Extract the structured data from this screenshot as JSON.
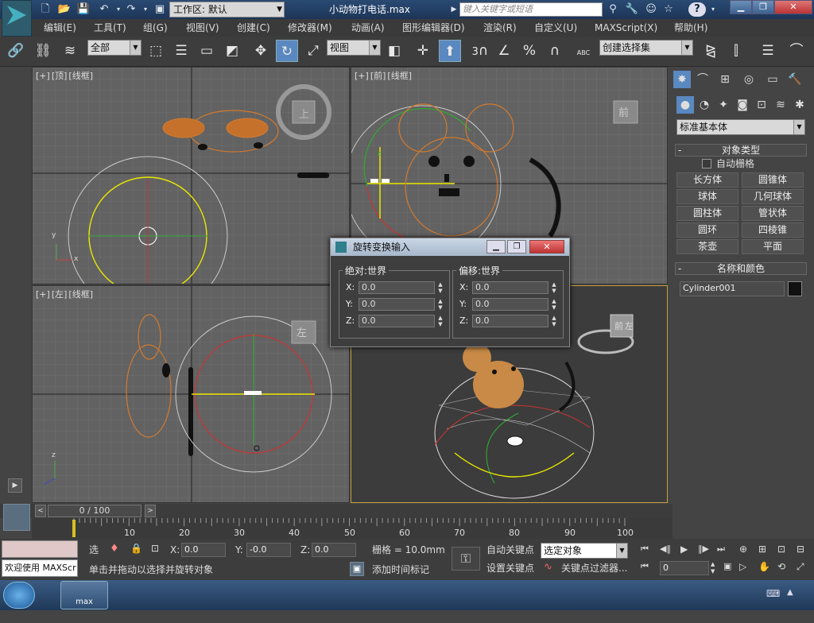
{
  "window": {
    "file_title": "小动物打电话.max",
    "workspace": "工作区: 默认",
    "search_placeholder": "键入关键字或短语",
    "title_icons": [
      "new-file",
      "open-folder",
      "save",
      "undo",
      "redo",
      "hold"
    ],
    "help": "?"
  },
  "menu": [
    "编辑(E)",
    "工具(T)",
    "组(G)",
    "视图(V)",
    "创建(C)",
    "修改器(M)",
    "动画(A)",
    "图形编辑器(D)",
    "渲染(R)",
    "自定义(U)",
    "MAXScript(X)",
    "帮助(H)"
  ],
  "toolbar": {
    "selection_filter": "全部",
    "ref_coord": "视图",
    "named_selection": "创建选择集",
    "snap_label": "3",
    "angle_snap": "%",
    "abc": "ABC"
  },
  "viewports": {
    "top": {
      "label": [
        "[+]",
        "[顶]",
        "[线框]"
      ],
      "cube": "上"
    },
    "front": {
      "label": [
        "[+]",
        "[前]",
        "[线框]"
      ],
      "cube": "前"
    },
    "left": {
      "label": [
        "[+]",
        "[左]",
        "[线框]"
      ],
      "cube": "左"
    },
    "persp": {
      "cube_front": "前",
      "cube_side": "左"
    }
  },
  "axes": {
    "x": "x",
    "y": "y",
    "z": "z"
  },
  "command_panel": {
    "dropdown": "标准基本体",
    "object_type_title": "对象类型",
    "autogrid": "自动栅格",
    "buttons": [
      "长方体",
      "圆锥体",
      "球体",
      "几何球体",
      "圆柱体",
      "管状体",
      "圆环",
      "四棱锥",
      "茶壶",
      "平面"
    ],
    "name_color_title": "名称和颜色",
    "object_name": "Cylinder001",
    "object_color": "#111111"
  },
  "dialog": {
    "title": "旋转变换输入",
    "abs_title": "绝对:世界",
    "off_title": "偏移:世界",
    "rows": [
      {
        "axis": "X:",
        "abs": "0.0",
        "off": "0.0"
      },
      {
        "axis": "Y:",
        "abs": "0.0",
        "off": "0.0"
      },
      {
        "axis": "Z:",
        "abs": "0.0",
        "off": "0.0"
      }
    ]
  },
  "timeline": {
    "frame": "0 / 100",
    "ticks": [
      "10",
      "20",
      "30",
      "40",
      "50",
      "60",
      "70",
      "80",
      "90",
      "100"
    ]
  },
  "status": {
    "maxscript": "欢迎使用 MAXScr",
    "selection": "选",
    "x_label": "X:",
    "x": "0.0",
    "y_label": "Y:",
    "y": "-0.0",
    "z_label": "Z:",
    "z": "0.0",
    "grid": "栅格 = 10.0mm",
    "prompt": "单击并拖动以选择并旋转对象",
    "add_time_tag": "添加时间标记",
    "auto_key": "自动关键点",
    "set_key": "设置关键点",
    "selected_object": "选定对象",
    "key_filters": "关键点过滤器...",
    "frame_field": "0"
  },
  "taskbar": {
    "app": "max"
  },
  "colors": {
    "accent": "#5a88c0",
    "selected_wire": "#e8e800",
    "object_wire": "#d27a30"
  }
}
